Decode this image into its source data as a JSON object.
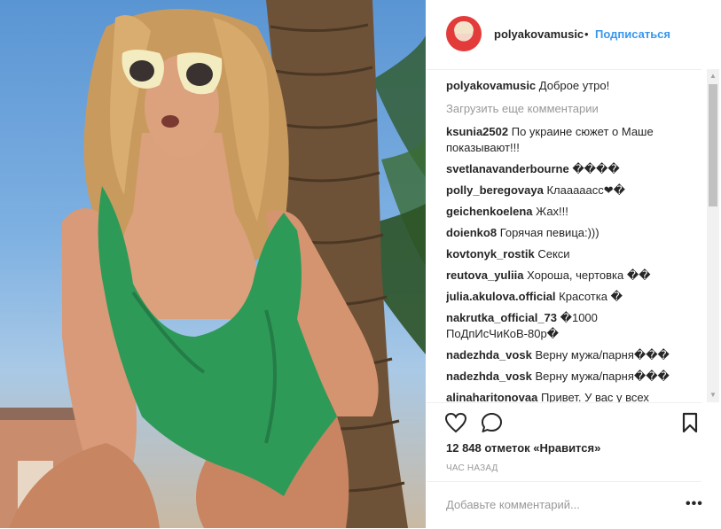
{
  "header": {
    "username": "polyakovamusic",
    "separator": "•",
    "follow_label": "Подписаться"
  },
  "caption": {
    "user": "polyakovamusic",
    "text": "Доброе утро!"
  },
  "load_more_label": "Загрузить еще комментарии",
  "comments": [
    {
      "user": "ksunia2502",
      "text": "По украине сюжет о Маше показывают!!!"
    },
    {
      "user": "svetlanavanderbourne",
      "text": "����"
    },
    {
      "user": "polly_beregovaya",
      "text": "Клааааасс❤�"
    },
    {
      "user": "geichenkoelena",
      "text": "Жах!!!"
    },
    {
      "user": "doienko8",
      "text": "Горячая певица:)))"
    },
    {
      "user": "kovtonyk_rostik",
      "text": "Секси"
    },
    {
      "user": "reutova_yuliia",
      "text": "Хороша, чертовка ��"
    },
    {
      "user": "julia.akulova.official",
      "text": "Красотка �"
    },
    {
      "user": "nakrutka_official_73",
      "text": "�1000 ПоДпИсЧиКоВ-80р�"
    },
    {
      "user": "nadezhda_vosk",
      "text": "Верну мужа/парня���"
    },
    {
      "user": "nadezhda_vosk",
      "text": "Верну мужа/парня���"
    },
    {
      "user": "alinaharitonovaa",
      "text": "Привет. У вас у всех"
    }
  ],
  "likes_text": "12 848 отметок «Нравится»",
  "timestamp": "ЧАС НАЗАД",
  "add_comment_placeholder": "Добавьте комментарий...",
  "more_label": "•••",
  "icons": {
    "like": "heart-icon",
    "comment": "comment-icon",
    "save": "bookmark-icon"
  },
  "colors": {
    "link": "#3897f0",
    "swimsuit": "#2e9a58",
    "muted": "#999999"
  }
}
